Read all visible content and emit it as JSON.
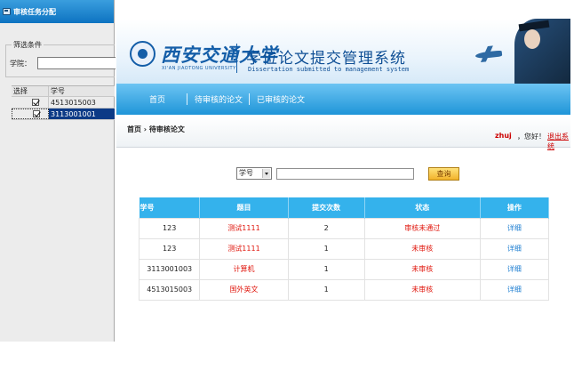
{
  "left_panel": {
    "title": "审核任务分配",
    "filter_legend": "筛选条件",
    "college_label": "学院：",
    "grid_headers": [
      "选择",
      "学号"
    ],
    "grid_rows": [
      {
        "checked": true,
        "student_id": "4513015003",
        "selected": false
      },
      {
        "checked": true,
        "student_id": "3113001001",
        "selected": true
      }
    ]
  },
  "banner": {
    "university_cn": "西安交通大学",
    "university_en": "XI'AN JIAOTONG UNIVERSITY",
    "system_title": "学位论文提交管理系统",
    "system_subtitle": "Dissertation submitted to management system"
  },
  "nav": {
    "items": [
      "首页",
      "待审核的论文",
      "已审核的论文"
    ]
  },
  "breadcrumb": "首页 › 待审核论文",
  "user": {
    "name": "zhuj",
    "greeting": "，您好！",
    "logout": "退出系统"
  },
  "search": {
    "field_selected": "学号",
    "button": "查询"
  },
  "table": {
    "headers": [
      "学号",
      "题目",
      "提交次数",
      "状态",
      "操作"
    ],
    "rows": [
      {
        "id": "123",
        "title": "测试1111",
        "count": "2",
        "status": "审核未通过",
        "action": "详细"
      },
      {
        "id": "123",
        "title": "测试1111",
        "count": "1",
        "status": "未审核",
        "action": "详细"
      },
      {
        "id": "3113001003",
        "title": "计算机",
        "count": "1",
        "status": "未审核",
        "action": "详细"
      },
      {
        "id": "4513015003",
        "title": "国外英文",
        "count": "1",
        "status": "未审核",
        "action": "详细"
      }
    ]
  },
  "colors": {
    "nav_blue": "#1f95d8",
    "header_blue": "#34b2ec",
    "status_red": "#e0160c",
    "link_blue": "#1d7ed1",
    "title_blue": "#145ea8"
  }
}
